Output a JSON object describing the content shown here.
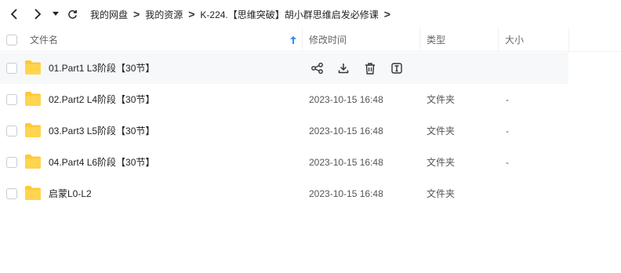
{
  "breadcrumb": [
    "我的网盘",
    "我的资源",
    "K-224.【思维突破】胡小群思维启发必修课"
  ],
  "columns": {
    "name": "文件名",
    "modified": "修改时间",
    "type": "类型",
    "size": "大小"
  },
  "files": [
    {
      "name": "01.Part1 L3阶段【30节】",
      "modified": "",
      "type": "",
      "size": ""
    },
    {
      "name": "02.Part2 L4阶段【30节】",
      "modified": "2023-10-15 16:48",
      "type": "文件夹",
      "size": "-"
    },
    {
      "name": "03.Part3 L5阶段【30节】",
      "modified": "2023-10-15 16:48",
      "type": "文件夹",
      "size": "-"
    },
    {
      "name": "04.Part4 L6阶段【30节】",
      "modified": "2023-10-15 16:48",
      "type": "文件夹",
      "size": "-"
    },
    {
      "name": "启蒙L0-L2",
      "modified": "2023-10-15 16:48",
      "type": "文件夹",
      "size": ""
    }
  ],
  "colors": {
    "folder": "#ffc934",
    "sort_arrow": "#2f8cff"
  }
}
